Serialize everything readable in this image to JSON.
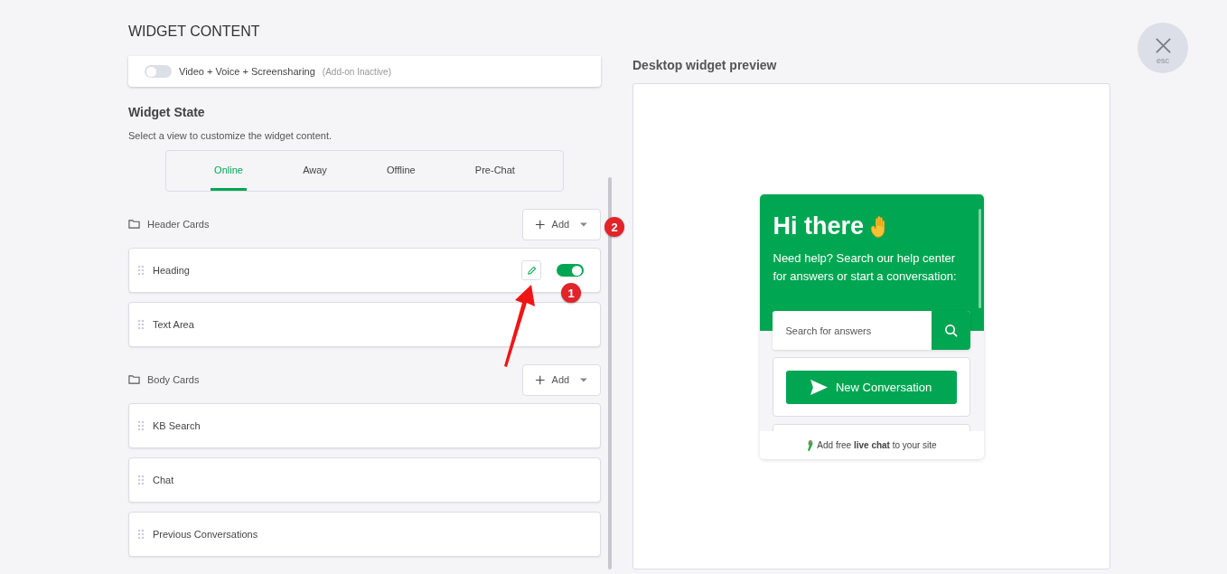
{
  "page_title": "WIDGET CONTENT",
  "close_button": {
    "label": "esc"
  },
  "addon": {
    "label": "Video + Voice + Screensharing",
    "note": "(Add-on Inactive)",
    "enabled": false
  },
  "widget_state": {
    "title": "Widget State",
    "subtitle": "Select a view to customize the widget content.",
    "tabs": [
      {
        "label": "Online",
        "selected": true
      },
      {
        "label": "Away",
        "selected": false
      },
      {
        "label": "Offline",
        "selected": false
      },
      {
        "label": "Pre-Chat",
        "selected": false
      }
    ]
  },
  "sections": [
    {
      "title": "Header Cards",
      "add_button": "Add",
      "cards": [
        {
          "label": "Heading",
          "edit_button": true,
          "enabled": true
        },
        {
          "label": "Text Area"
        }
      ]
    },
    {
      "title": "Body Cards",
      "add_button": "Add",
      "cards": [
        {
          "label": "KB Search"
        },
        {
          "label": "Chat"
        },
        {
          "label": "Previous Conversations"
        }
      ]
    }
  ],
  "annotations": [
    {
      "label": "1"
    },
    {
      "label": "2"
    }
  ],
  "preview": {
    "title": "Desktop widget preview",
    "greeting": "Hi there",
    "message": "Need help? Search our help center for answers or start a conversation:",
    "search_placeholder": "Search for answers",
    "button": "New Conversation",
    "footer": "Add free **live chat** to your site"
  }
}
